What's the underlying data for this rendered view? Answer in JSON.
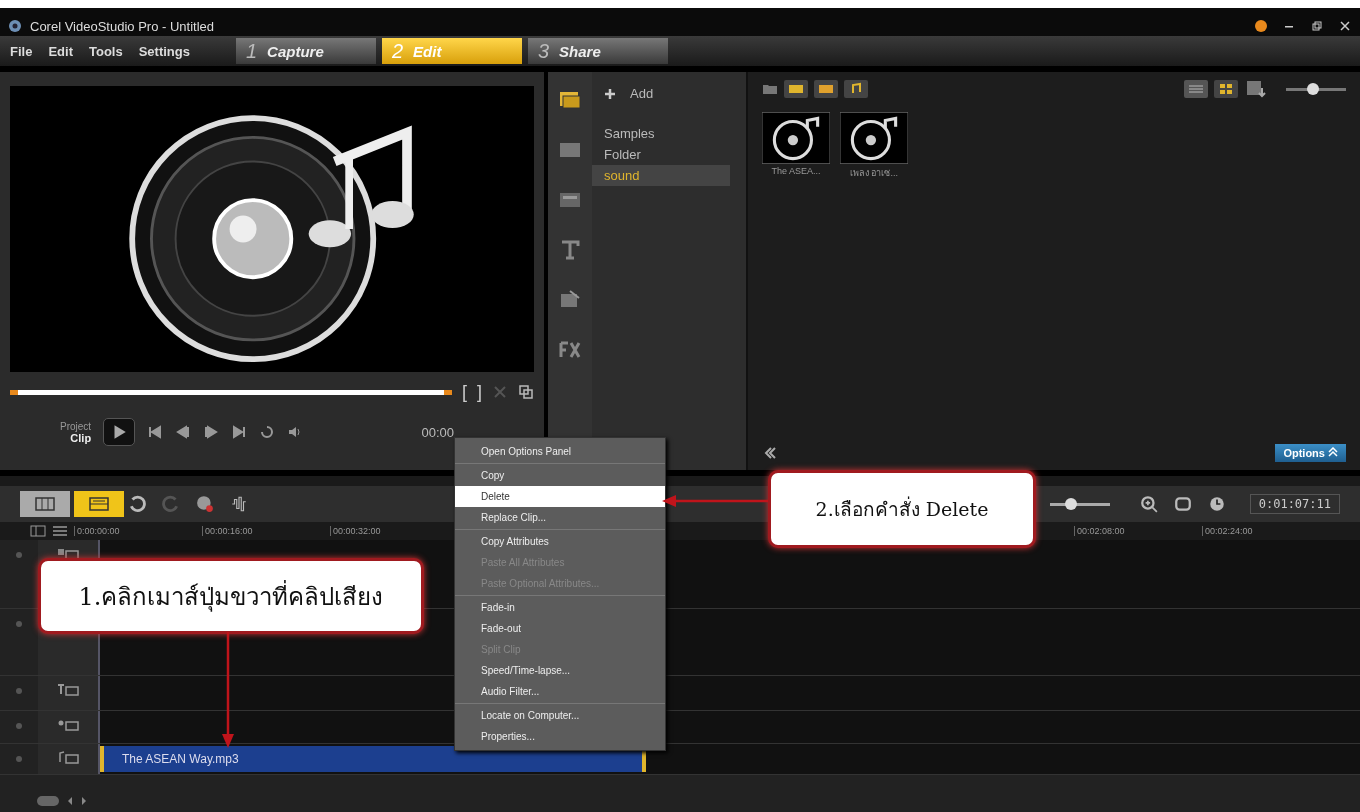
{
  "window": {
    "title": "Corel VideoStudio Pro - Untitled"
  },
  "menu_bar": [
    "File",
    "Edit",
    "Tools",
    "Settings"
  ],
  "steps": [
    {
      "number": "1",
      "label": "Capture",
      "selected": false
    },
    {
      "number": "2",
      "label": "Edit",
      "selected": true
    },
    {
      "number": "3",
      "label": "Share",
      "selected": false
    }
  ],
  "preview": {
    "project_label": "Project",
    "clip_label": "Clip",
    "mark_in": "[",
    "mark_out": "]",
    "timecode": "00:00"
  },
  "library": {
    "add": "Add",
    "folders": [
      {
        "label": "Samples",
        "selected": false
      },
      {
        "label": "Folder",
        "selected": false
      },
      {
        "label": "sound",
        "selected": true
      }
    ],
    "items": [
      {
        "caption": "The ASEA..."
      },
      {
        "caption": "เพลง อาเซ..."
      }
    ],
    "options": "Options",
    "size_slider": {
      "level": 0.45
    }
  },
  "timeline": {
    "view_buttons": [
      {
        "kind": "storyboard",
        "selected": false
      },
      {
        "kind": "timeline",
        "selected": true
      }
    ],
    "timecode": "0:01:07:11",
    "zoom_slider": {
      "level": 0.35
    },
    "ruler_left": [
      "0:00:00:00",
      "00:00:16:00",
      "00:00:32:00"
    ],
    "ruler_right": [
      "00:02:08:00",
      "00:02:24:00"
    ],
    "tracks": [
      {
        "kind": "video"
      },
      {
        "kind": "overlay"
      },
      {
        "kind": "title"
      },
      {
        "kind": "voice"
      },
      {
        "kind": "music",
        "clip": "The ASEAN Way.mp3"
      }
    ]
  },
  "context_menu": {
    "groups": [
      [
        {
          "label": "Open Options Panel",
          "disabled": false,
          "selected": false
        }
      ],
      [
        {
          "label": "Copy",
          "disabled": false,
          "selected": false
        },
        {
          "label": "Delete",
          "disabled": false,
          "selected": true
        },
        {
          "label": "Replace Clip...",
          "disabled": false,
          "selected": false
        }
      ],
      [
        {
          "label": "Copy Attributes",
          "disabled": false,
          "selected": false
        },
        {
          "label": "Paste All Attributes",
          "disabled": true,
          "selected": false
        },
        {
          "label": "Paste Optional Attributes...",
          "disabled": true,
          "selected": false
        }
      ],
      [
        {
          "label": "Fade-in",
          "disabled": false,
          "selected": false
        },
        {
          "label": "Fade-out",
          "disabled": false,
          "selected": false
        },
        {
          "label": "Split Clip",
          "disabled": true,
          "selected": false
        },
        {
          "label": "Speed/Time-lapse...",
          "disabled": false,
          "selected": false
        },
        {
          "label": "Audio Filter...",
          "disabled": false,
          "selected": false
        }
      ],
      [
        {
          "label": "Locate on Computer...",
          "disabled": false,
          "selected": false
        },
        {
          "label": "Properties...",
          "disabled": false,
          "selected": false
        }
      ]
    ]
  },
  "callouts": [
    {
      "text": "1.คลิกเมาส์ปุ่มขวาที่คลิปเสียง"
    },
    {
      "text": "2.เลือกคำสั่ง Delete"
    }
  ]
}
